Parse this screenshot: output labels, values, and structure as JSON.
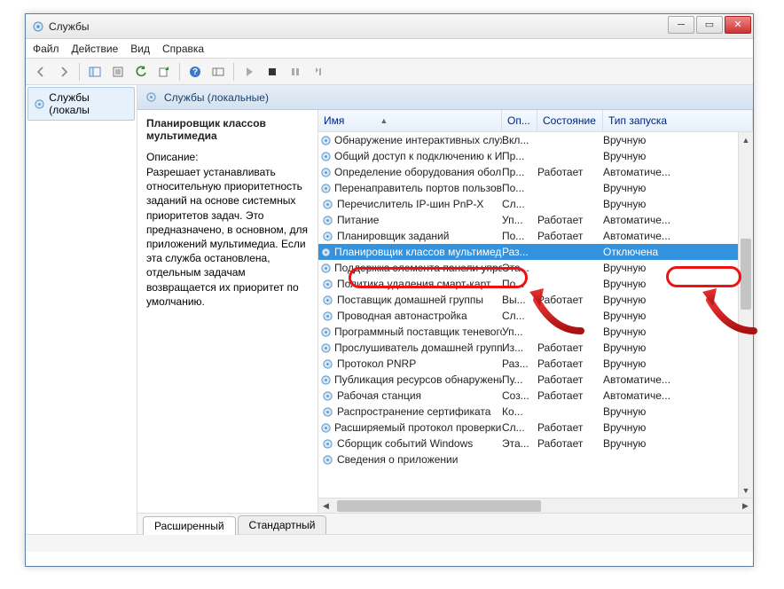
{
  "window": {
    "title": "Службы"
  },
  "menu": {
    "file": "Файл",
    "action": "Действие",
    "view": "Вид",
    "help": "Справка"
  },
  "tree": {
    "item": "Службы (локалы"
  },
  "header": {
    "label": "Службы (локальные)"
  },
  "detail": {
    "title": "Планировщик классов мультимедиа",
    "desc_label": "Описание:",
    "desc": "Разрешает устанавливать относительную приоритетность заданий на основе системных приоритетов задач. Это предназначено, в основном, для приложений мультимедиа. Если эта служба остановлена, отдельным задачам возвращается их приоритет по умолчанию."
  },
  "columns": {
    "name": "Имя",
    "desc": "Оп...",
    "state": "Состояние",
    "stype": "Тип запуска"
  },
  "services": [
    {
      "name": "Обнаружение интерактивных служб",
      "desc": "Вкл...",
      "state": "",
      "stype": "Вручную",
      "sel": false
    },
    {
      "name": "Общий доступ к подключению к И...",
      "desc": "Пр...",
      "state": "",
      "stype": "Вручную",
      "sel": false
    },
    {
      "name": "Определение оборудования оболо...",
      "desc": "Пр...",
      "state": "Работает",
      "stype": "Автоматиче...",
      "sel": false
    },
    {
      "name": "Перенаправитель портов пользоват...",
      "desc": "По...",
      "state": "",
      "stype": "Вручную",
      "sel": false
    },
    {
      "name": "Перечислитель IP-шин PnP-X",
      "desc": "Сл...",
      "state": "",
      "stype": "Вручную",
      "sel": false
    },
    {
      "name": "Питание",
      "desc": "Уп...",
      "state": "Работает",
      "stype": "Автоматиче...",
      "sel": false
    },
    {
      "name": "Планировщик заданий",
      "desc": "По...",
      "state": "Работает",
      "stype": "Автоматиче...",
      "sel": false
    },
    {
      "name": "Планировщик классов мультимедиа",
      "desc": "Раз...",
      "state": "",
      "stype": "Отключена",
      "sel": true
    },
    {
      "name": "Поддержка элемента панели управ...",
      "desc": "Эта...",
      "state": "",
      "stype": "Вручную",
      "sel": false
    },
    {
      "name": "Политика удаления смарт-карт",
      "desc": "По...",
      "state": "",
      "stype": "Вручную",
      "sel": false
    },
    {
      "name": "Поставщик домашней группы",
      "desc": "Вы...",
      "state": "Работает",
      "stype": "Вручную",
      "sel": false
    },
    {
      "name": "Проводная автонастройка",
      "desc": "Сл...",
      "state": "",
      "stype": "Вручную",
      "sel": false
    },
    {
      "name": "Программный поставщик теневого...",
      "desc": "Уп...",
      "state": "",
      "stype": "Вручную",
      "sel": false
    },
    {
      "name": "Прослушиватель домашней группы",
      "desc": "Из...",
      "state": "Работает",
      "stype": "Вручную",
      "sel": false
    },
    {
      "name": "Протокол PNRP",
      "desc": "Раз...",
      "state": "Работает",
      "stype": "Вручную",
      "sel": false
    },
    {
      "name": "Публикация ресурсов обнаружения...",
      "desc": "Пу...",
      "state": "Работает",
      "stype": "Автоматиче...",
      "sel": false
    },
    {
      "name": "Рабочая станция",
      "desc": "Соз...",
      "state": "Работает",
      "stype": "Автоматиче...",
      "sel": false
    },
    {
      "name": "Распространение сертификата",
      "desc": "Ко...",
      "state": "",
      "stype": "Вручную",
      "sel": false
    },
    {
      "name": "Расширяемый протокол проверки ...",
      "desc": "Сл...",
      "state": "Работает",
      "stype": "Вручную",
      "sel": false
    },
    {
      "name": "Сборщик событий Windows",
      "desc": "Эта...",
      "state": "Работает",
      "stype": "Вручную",
      "sel": false
    },
    {
      "name": "Сведения о приложении",
      "desc": "",
      "state": "",
      "stype": "",
      "sel": false
    }
  ],
  "tabs": {
    "extended": "Расширенный",
    "standard": "Стандартный"
  }
}
